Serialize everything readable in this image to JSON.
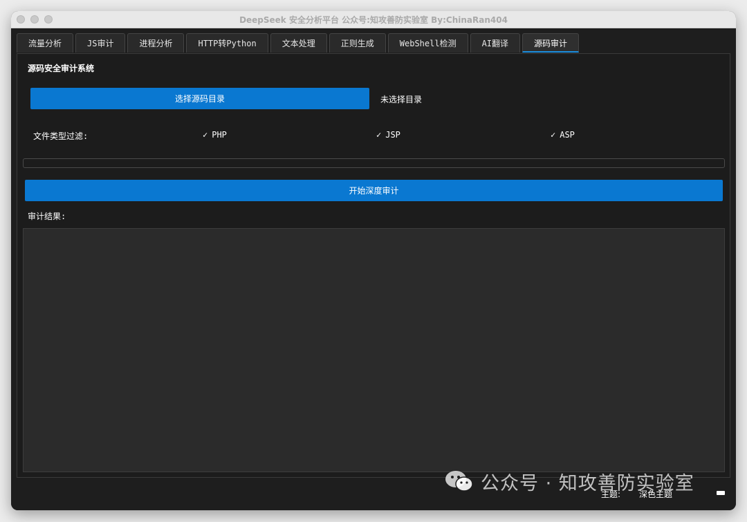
{
  "window": {
    "title": "DeepSeek 安全分析平台 公众号:知攻善防实验室 By:ChinaRan404"
  },
  "tabs": [
    {
      "label": "流量分析"
    },
    {
      "label": "JS审计"
    },
    {
      "label": "进程分析"
    },
    {
      "label": "HTTP转Python"
    },
    {
      "label": "文本处理"
    },
    {
      "label": "正则生成"
    },
    {
      "label": "WebShell检测"
    },
    {
      "label": "AI翻译"
    },
    {
      "label": "源码审计",
      "active": true
    }
  ],
  "panel": {
    "title": "源码安全审计系统",
    "select_dir_button": "选择源码目录",
    "selected_dir": "未选择目录",
    "filter_label": "文件类型过滤:",
    "filters": [
      {
        "label": "PHP",
        "checked": true
      },
      {
        "label": "JSP",
        "checked": true
      },
      {
        "label": "ASP",
        "checked": true
      }
    ],
    "check_mark": "✓",
    "progress": 0,
    "start_button": "开始深度审计",
    "results_label": "审计结果:"
  },
  "footer": {
    "theme_label": "主题:",
    "theme_value": "深色主题"
  },
  "watermark": {
    "text": "公众号 · 知攻善防实验室"
  },
  "colors": {
    "accent": "#0a78d1",
    "background": "#1e1e1e",
    "results_bg": "#2b2b2b"
  }
}
